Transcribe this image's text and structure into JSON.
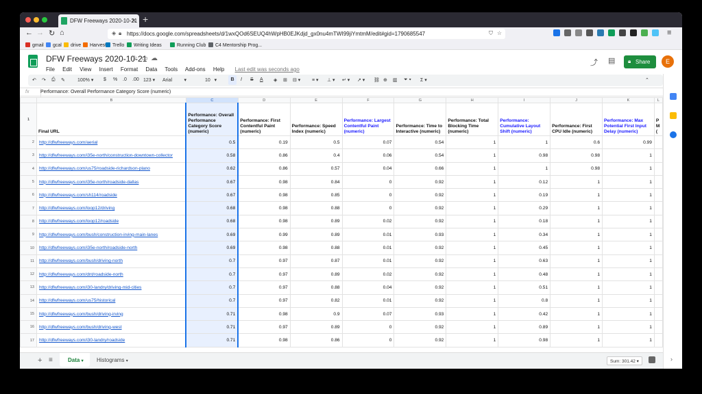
{
  "browser": {
    "tab_title": "DFW Freeways 2020-10-21 - G",
    "url": "https://docs.google.com/spreadsheets/d/1wxQOd6SEUQ4hWpHB0EJKdjd_gx0nu4mTWI99jiYmtmM/edit#gid=1790685547",
    "bookmarks": [
      "gmail",
      "gcal",
      "drive",
      "Harvest",
      "Trello",
      "Writing Ideas",
      "Running Club",
      "C4 Mentorship Prog..."
    ]
  },
  "doc": {
    "title": "DFW Freeways 2020-10-21",
    "menu": [
      "File",
      "Edit",
      "View",
      "Insert",
      "Format",
      "Data",
      "Tools",
      "Add-ons",
      "Help"
    ],
    "last_edit": "Last edit was seconds ago",
    "share_label": "Share",
    "account_initial": "E"
  },
  "toolbar": {
    "zoom": "100%",
    "currency": "$",
    "percent": "%",
    "decimal_less": ".0",
    "decimal_more": ".00",
    "more_formats": "123",
    "font": "Arial",
    "font_size": "10",
    "bold": "B",
    "italic": "I",
    "strike": "S",
    "text_color": "A",
    "functions": "Σ"
  },
  "formula_bar": {
    "fx": "fx",
    "content": "Performance: Overall Performance Category Score (numeric)"
  },
  "grid": {
    "columns": [
      "B",
      "C",
      "D",
      "E",
      "F",
      "G",
      "H",
      "I",
      "J",
      "K",
      "L"
    ],
    "header_row": {
      "row_num": "1",
      "cells": [
        "Final URL",
        "Performance: Overall Performance Category Score (numeric)",
        "Performance: First Contentful Paint (numeric)",
        "Performance: Speed Index (numeric)",
        "Performance: Largest Contentful Paint (numeric)",
        "Performance: Time to Interactive (numeric)",
        "Performance: Total Blocking Time (numeric)",
        "Performance: Cumulative Layout Shift (numeric)",
        "Performance: First CPU Idle (numeric)",
        "Performance: Max Potential First Input Delay (numeric)",
        "P M ("
      ]
    },
    "rows": [
      {
        "n": "2",
        "url": "http://dfwfreeways.com/aerial",
        "v": [
          "0.5",
          "0.19",
          "0.5",
          "0.07",
          "0.54",
          "1",
          "1",
          "0.6",
          "0.99"
        ]
      },
      {
        "n": "3",
        "url": "http://dfwfreeways.com/i35e-north/construction-downtown-collector",
        "v": [
          "0.58",
          "0.86",
          "0.4",
          "0.06",
          "0.54",
          "1",
          "0.98",
          "0.98",
          "1"
        ]
      },
      {
        "n": "4",
        "url": "http://dfwfreeways.com/us75/roadside-richardson-plano",
        "v": [
          "0.62",
          "0.86",
          "0.57",
          "0.04",
          "0.66",
          "1",
          "1",
          "0.98",
          "1"
        ]
      },
      {
        "n": "5",
        "url": "http://dfwfreeways.com/i35e-north/roadside-dallas",
        "v": [
          "0.67",
          "0.98",
          "0.84",
          "0",
          "0.92",
          "1",
          "0.12",
          "1",
          "1"
        ]
      },
      {
        "n": "6",
        "url": "http://dfwfreeways.com/sh114/roadside",
        "v": [
          "0.67",
          "0.98",
          "0.85",
          "0",
          "0.92",
          "1",
          "0.19",
          "1",
          "1"
        ]
      },
      {
        "n": "7",
        "url": "http://dfwfreeways.com/loop12/driving",
        "v": [
          "0.68",
          "0.98",
          "0.88",
          "0",
          "0.92",
          "1",
          "0.29",
          "1",
          "1"
        ]
      },
      {
        "n": "8",
        "url": "http://dfwfreeways.com/loop12/roadside",
        "v": [
          "0.68",
          "0.98",
          "0.89",
          "0.02",
          "0.92",
          "1",
          "0.18",
          "1",
          "1"
        ]
      },
      {
        "n": "9",
        "url": "http://dfwfreeways.com/bush/construction-irving-main-lanes",
        "v": [
          "0.69",
          "0.99",
          "0.89",
          "0.01",
          "0.93",
          "1",
          "0.34",
          "1",
          "1"
        ]
      },
      {
        "n": "10",
        "url": "http://dfwfreeways.com/i35e-north/roadside-north",
        "v": [
          "0.69",
          "0.98",
          "0.88",
          "0.01",
          "0.92",
          "1",
          "0.45",
          "1",
          "1"
        ]
      },
      {
        "n": "11",
        "url": "http://dfwfreeways.com/bush/driving-north",
        "v": [
          "0.7",
          "0.97",
          "0.87",
          "0.01",
          "0.92",
          "1",
          "0.63",
          "1",
          "1"
        ]
      },
      {
        "n": "12",
        "url": "http://dfwfreeways.com/dnt/roadside-north",
        "v": [
          "0.7",
          "0.97",
          "0.89",
          "0.02",
          "0.92",
          "1",
          "0.48",
          "1",
          "1"
        ]
      },
      {
        "n": "13",
        "url": "http://dfwfreeways.com/i30-landry/driving-mid-cities",
        "v": [
          "0.7",
          "0.97",
          "0.88",
          "0.04",
          "0.92",
          "1",
          "0.51",
          "1",
          "1"
        ]
      },
      {
        "n": "14",
        "url": "http://dfwfreeways.com/us75/historical",
        "v": [
          "0.7",
          "0.97",
          "0.82",
          "0.01",
          "0.92",
          "1",
          "0.8",
          "1",
          "1"
        ]
      },
      {
        "n": "15",
        "url": "http://dfwfreeways.com/bush/driving-irving",
        "v": [
          "0.71",
          "0.98",
          "0.9",
          "0.07",
          "0.93",
          "1",
          "0.42",
          "1",
          "1"
        ]
      },
      {
        "n": "16",
        "url": "http://dfwfreeways.com/bush/driving-west",
        "v": [
          "0.71",
          "0.97",
          "0.89",
          "0",
          "0.92",
          "1",
          "0.89",
          "1",
          "1"
        ]
      },
      {
        "n": "17",
        "url": "http://dfwfreeways.com/i30-landry/roadside",
        "v": [
          "0.71",
          "0.98",
          "0.86",
          "0",
          "0.92",
          "1",
          "0.98",
          "1",
          "1"
        ]
      }
    ]
  },
  "sheets": {
    "active": "Data",
    "other": "Histograms",
    "sum": "Sum: 301.42"
  },
  "colors": {
    "accent": "#1a73e8",
    "share_green": "#1e8e3e",
    "link_blue": "#1155cc"
  }
}
